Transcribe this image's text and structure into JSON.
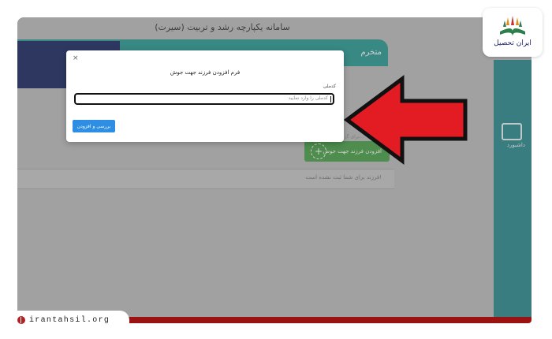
{
  "app": {
    "header_title": "سامانه یکپارچه رشد و تربیت (سیرت)",
    "sidebar_label": "داشبورد"
  },
  "background": {
    "welcome_text": "متخرم",
    "add_child_button": "افزودن فرزند جهت جوش",
    "faint_row_text": "فرزند برای شما ثبت نشده است!",
    "faint_hint": "برای گزارش فرزندی..."
  },
  "modal": {
    "close_glyph": "×",
    "title": "فرم افزودن فرزند جهت جوش",
    "field_label": "کدملی",
    "field_placeholder": "کدملی را وارد نمایید",
    "submit_label": "بررسی و افزودن"
  },
  "brand": {
    "logo_text": "ایران تحصیل",
    "site_url": "irantahsil.org"
  },
  "colors": {
    "accent_red": "#e31b23",
    "teal": "#2c9a94",
    "navy": "#1c2a63",
    "green": "#4aa14a",
    "blue_button": "#2d8ee3",
    "bottom_bar": "#9a1212"
  },
  "icons": {
    "arrow": "big-red-arrow-left-icon",
    "logo": "book-leaf-logo-icon",
    "globe": "globe-icon",
    "plus": "plus-circle-icon",
    "dashboard": "dashboard-icon"
  }
}
